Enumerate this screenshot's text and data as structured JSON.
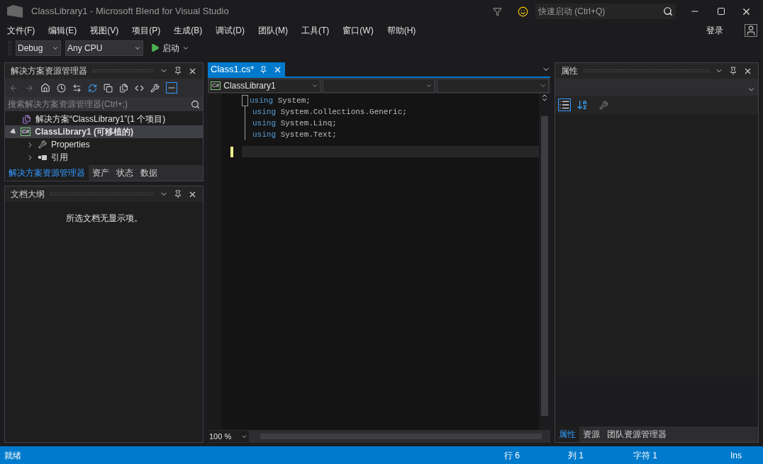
{
  "window": {
    "title": "ClassLibrary1 - Microsoft Blend for Visual Studio"
  },
  "quick_launch": {
    "placeholder": "快速启动 (Ctrl+Q)"
  },
  "menu": [
    "文件(F)",
    "编辑(E)",
    "视图(V)",
    "项目(P)",
    "生成(B)",
    "调试(D)",
    "团队(M)",
    "工具(T)",
    "窗口(W)",
    "帮助(H)"
  ],
  "sign_in": "登录",
  "toolbar": {
    "configuration": "Debug",
    "platform": "Any CPU",
    "start": "启动"
  },
  "solution_explorer": {
    "title": "解决方案资源管理器",
    "search": {
      "placeholder": "搜索解决方案资源管理器(Ctrl+;)"
    },
    "tree": [
      {
        "kind": "solution",
        "label": "解决方案“ClassLibrary1”(1 个项目)",
        "selected": false,
        "children": [
          {
            "kind": "project",
            "label": "ClassLibrary1 (可移植的)",
            "badge": "C#",
            "selected": true,
            "expanded": true,
            "children": [
              {
                "kind": "properties",
                "label": "Properties",
                "selected": false,
                "expanded": false
              },
              {
                "kind": "references",
                "label": "引用",
                "selected": false,
                "expanded": false
              }
            ]
          }
        ]
      }
    ],
    "tabs": [
      {
        "label": "解决方案资源管理器",
        "selected": true
      },
      {
        "label": "资产",
        "selected": false
      },
      {
        "label": "状态",
        "selected": false
      },
      {
        "label": "数据",
        "selected": false
      }
    ]
  },
  "document_outline": {
    "title": "文档大纲",
    "message": "所选文档无显示项。"
  },
  "editor": {
    "tab": {
      "label": "Class1.cs*",
      "selected": true
    },
    "navigation": {
      "label": "ClassLibrary1",
      "badge": "C#"
    },
    "lines": [
      {
        "keyword": "using",
        "text": "System;"
      },
      {
        "keyword": "using",
        "text": "System.Collections.Generic;"
      },
      {
        "keyword": "using",
        "text": "System.Linq;"
      },
      {
        "keyword": "using",
        "text": "System.Text;"
      }
    ],
    "zoom": "100 %"
  },
  "properties": {
    "title": "属性",
    "tabs": [
      {
        "label": "属性",
        "selected": true
      },
      {
        "label": "资源",
        "selected": false
      },
      {
        "label": "团队资源管理器",
        "selected": false
      }
    ]
  },
  "status_bar": {
    "message": "就绪",
    "line": "行 6",
    "column": "列 1",
    "char": "字符 1",
    "mode": "Ins"
  }
}
